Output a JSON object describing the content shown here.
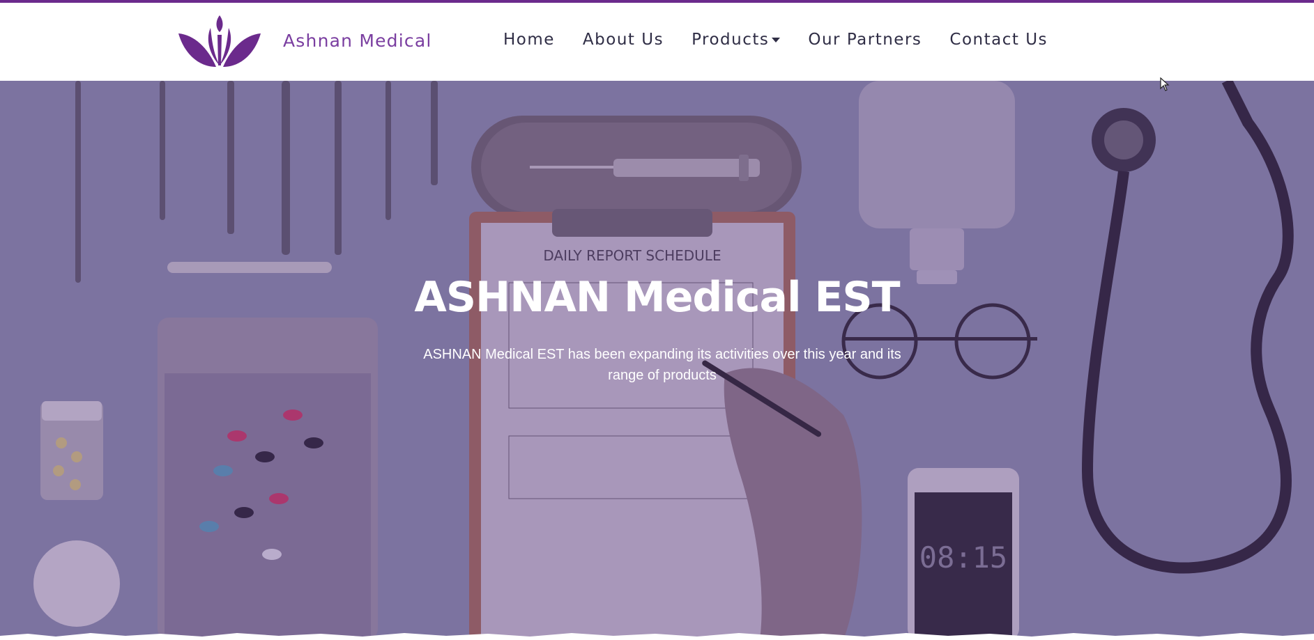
{
  "header": {
    "brand_name": "Ashnan Medical",
    "logo_icon": "lotus-logo-icon",
    "accent_color": "#6b2a8c"
  },
  "nav": {
    "items": [
      {
        "label": "Home"
      },
      {
        "label": "About Us"
      },
      {
        "label": "Products",
        "icon": "caret-down-icon"
      },
      {
        "label": "Our Partners"
      },
      {
        "label": "Contact Us"
      }
    ]
  },
  "hero": {
    "title": "ASHNAN Medical EST",
    "subtitle": "ASHNAN Medical EST has been expanding its activities over this year and its range of products",
    "phone_clock": "08:15",
    "clipboard_heading": "DAILY REPORT SCHEDULE"
  }
}
